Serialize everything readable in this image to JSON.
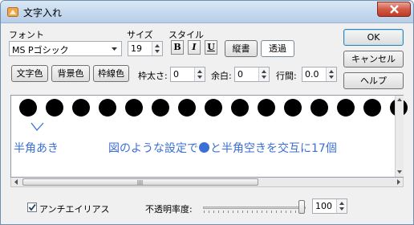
{
  "window": {
    "title": "文字入れ"
  },
  "font": {
    "label": "フォント",
    "value": "MS Pゴシック"
  },
  "size": {
    "label": "サイズ",
    "value": "19"
  },
  "style": {
    "label": "スタイル",
    "bold": "B",
    "italic": "I",
    "underline": "U"
  },
  "buttons": {
    "vertical": "縦書",
    "transparent": "透過",
    "ok": "OK",
    "cancel": "キャンセル",
    "help": "ヘルプ",
    "text_color": "文字色",
    "bg_color": "背景色",
    "border_color": "枠線色"
  },
  "border_width": {
    "label": "枠太さ:",
    "value": "0"
  },
  "margin": {
    "label": "余白:",
    "value": "0"
  },
  "line_spacing": {
    "label": "行間:",
    "value": "0.0"
  },
  "preview": {
    "dot_count": 17,
    "dot_color": "#000000",
    "annotation_color": "#3b6fd6",
    "note_left": "半角あき",
    "note_main_prefix": "図のような設定で",
    "note_main_suffix": "と半角空きを交互に17個"
  },
  "antialias": {
    "label": "アンチエイリアス",
    "checked": true
  },
  "opacity": {
    "label": "不透明率度:",
    "value": "100"
  }
}
